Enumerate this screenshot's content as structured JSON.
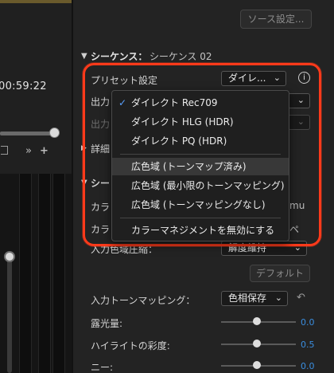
{
  "left": {
    "timecode": "00:59:22",
    "tools": [
      "»",
      "+"
    ]
  },
  "source_settings": "ソース設定...",
  "sequence": {
    "label": "シーケンス：",
    "name": "シーケンス 02"
  },
  "preset": {
    "label": "プリセット設定",
    "value": "ダイレ..."
  },
  "output_label": "出力",
  "output2_label": "出力",
  "details_label": "詳細",
  "section2_label": "シー",
  "color_row1_label": "カラ",
  "color_row1_suffix": "mu",
  "color_row2_label": "カラ",
  "color_row2_suffix": "ペ",
  "input_gamut": {
    "label": "入力色域圧縮：",
    "value": "解度維持"
  },
  "default_button": "デフォルト",
  "input_tone": {
    "label": "入力トーンマッピング：",
    "value": "色相保存"
  },
  "exposure": {
    "label": "露光量:",
    "value": "0.0"
  },
  "highlight_saturation": {
    "label": "ハイライトの彩度:",
    "value": "0.5"
  },
  "knee": {
    "label": "ニー:",
    "value": "0.0"
  },
  "menu": {
    "items": [
      {
        "label": "ダイレクト Rec709",
        "checked": true
      },
      {
        "label": "ダイレクト HLG (HDR)"
      },
      {
        "label": "ダイレクト PQ (HDR)"
      },
      {
        "label": "広色域 (トーンマップ済み)",
        "highlighted": true
      },
      {
        "label": "広色域 (最小限のトーンマッピング)"
      },
      {
        "label": "広色域 (トーンマッピングなし)"
      },
      {
        "label": "カラーマネジメントを無効にする"
      }
    ]
  },
  "colors": {
    "accent_red": "#ff3a1a",
    "check_blue": "#5aa1ff",
    "value_blue": "#3a8dde"
  }
}
